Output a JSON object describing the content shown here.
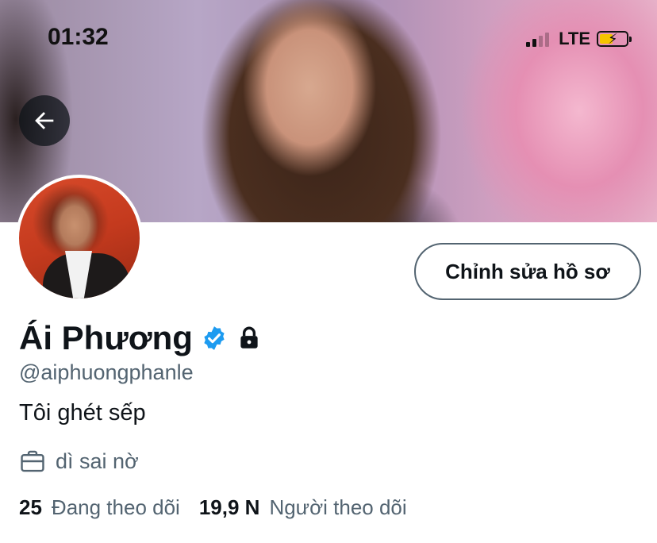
{
  "status_bar": {
    "time": "01:32",
    "network": "LTE"
  },
  "icons": {
    "back": "arrow-left-icon",
    "verified": "verified-badge-icon",
    "protected": "lock-icon",
    "job": "briefcase-icon"
  },
  "colors": {
    "verified_blue": "#1d9bf0",
    "secondary_text": "#536471",
    "primary_text": "#0f1419",
    "battery_fill": "#f5c400"
  },
  "profile": {
    "display_name": "Ái Phương",
    "handle": "@aiphuongphanle",
    "bio": "Tôi ghét sếp",
    "job": "dì sai nờ",
    "edit_button_label": "Chỉnh sửa hồ sơ"
  },
  "stats": {
    "following_count": "25",
    "following_label": "Đang theo dõi",
    "followers_count": "19,9 N",
    "followers_label": "Người theo dõi"
  }
}
